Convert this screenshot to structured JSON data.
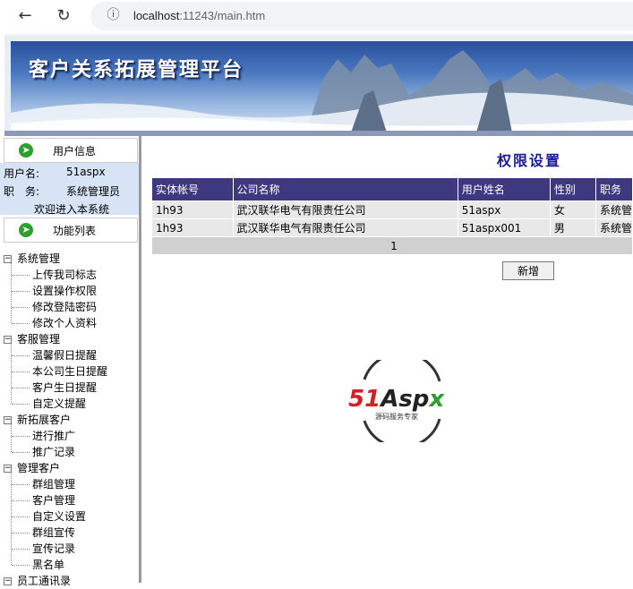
{
  "browser": {
    "url_host": "localhost",
    "url_rest": ":11243/main.htm",
    "info_icon": "ⓘ"
  },
  "banner": {
    "title": "客户关系拓展管理平台"
  },
  "user_panel": {
    "title": "用户信息",
    "username_label": "用户名:",
    "username": "51aspx",
    "role_label": "职　务:",
    "role": "系统管理员",
    "welcome": "欢迎进入本系统"
  },
  "func_panel": {
    "title": "功能列表"
  },
  "tree": [
    {
      "label": "系统管理",
      "children": [
        "上传我司标志",
        "设置操作权限",
        "修改登陆密码",
        "修改个人资料"
      ]
    },
    {
      "label": "客服管理",
      "children": [
        "温馨假日提醒",
        "本公司生日提醒",
        "客户生日提醒",
        "自定义提醒"
      ]
    },
    {
      "label": "新拓展客户",
      "children": [
        "进行推广",
        "推广记录"
      ]
    },
    {
      "label": "管理客户",
      "children": [
        "群组管理",
        "客户管理",
        "自定义设置",
        "群组宣传",
        "宣传记录",
        "黑名单"
      ]
    },
    {
      "label": "员工通讯录",
      "children": []
    }
  ],
  "main": {
    "title": "权限设置",
    "columns": [
      "实体帐号",
      "公司名称",
      "用户姓名",
      "性别",
      "职务"
    ],
    "rows": [
      [
        "1h93",
        "武汉联华电气有限责任公司",
        "51aspx",
        "女",
        "系统管"
      ],
      [
        "1h93",
        "武汉联华电气有限责任公司",
        "51aspx001",
        "男",
        "系统管"
      ]
    ],
    "pager": "1",
    "add_button": "新增"
  },
  "logo": {
    "text": "51Aspx",
    "sub": "源码服务专家",
    "red": "#d42020",
    "green": "#2ca02c"
  }
}
